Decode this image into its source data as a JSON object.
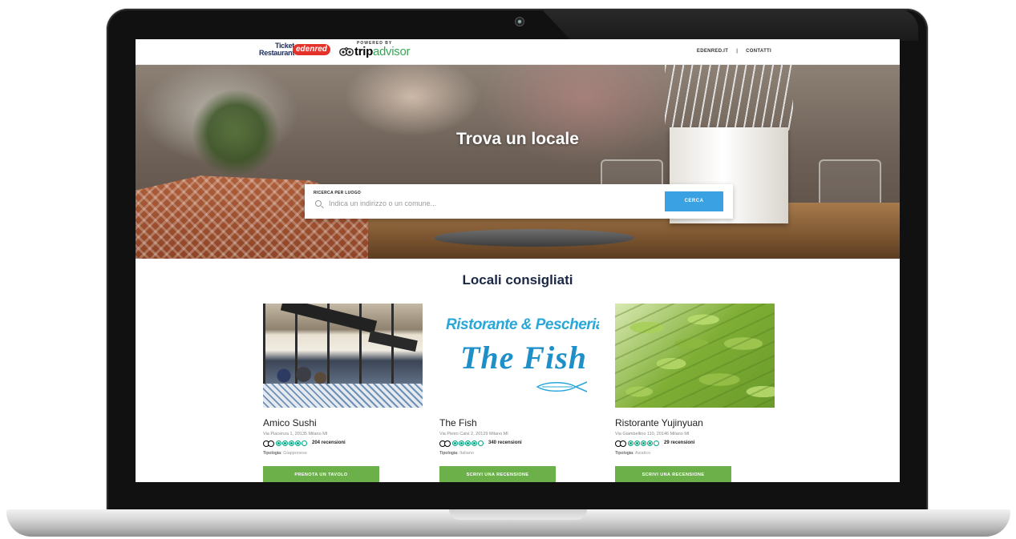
{
  "header": {
    "ticket_line1": "Ticket",
    "ticket_line2": "Restaurant",
    "edenred": "edenred",
    "powered_by": "POWERED BY",
    "tripadvisor_a": "trip",
    "tripadvisor_b": "advisor",
    "nav": [
      {
        "label": "EDENRED.IT"
      },
      {
        "label": "CONTATTI"
      }
    ],
    "nav_separator": "|"
  },
  "hero": {
    "title": "Trova un locale",
    "search_label": "RICERCA PER LUOGO",
    "search_placeholder": "Indica un indirizzo o un comune...",
    "search_button": "CERCA"
  },
  "recommended": {
    "title": "Locali consigliati",
    "cards": [
      {
        "name": "Amico Sushi",
        "address": "Via Piacenza 1, 20135 Milano MI",
        "rating_bubbles": 4,
        "reviews": "204 recensioni",
        "type_label": "Tipologia:",
        "type_value": "Giapponese",
        "button": "PRENOTA UN TAVOLO"
      },
      {
        "name": "The Fish",
        "address": "Via Pietro Calvi 2, 20129 Milano MI",
        "rating_bubbles": 4,
        "reviews": "340 recensioni",
        "type_label": "Tipologia:",
        "type_value": "Italiano",
        "button": "SCRIVI UNA RECENSIONE",
        "logo_line1": "Ristorante & Pescheria",
        "logo_line2": "The Fish"
      },
      {
        "name": "Ristorante Yujinyuan",
        "address": "Via Giambellino 110, 20146 Milano MI",
        "rating_bubbles": 4,
        "reviews": "29 recensioni",
        "type_label": "Tipologia:",
        "type_value": "Asiatico",
        "button": "SCRIVI UNA RECENSIONE"
      }
    ]
  },
  "colors": {
    "accent_blue": "#3aa2e2",
    "button_green": "#6cb04a",
    "tripadvisor_green": "#00a680",
    "title_navy": "#1a2745",
    "edenred_red": "#e4322b"
  }
}
